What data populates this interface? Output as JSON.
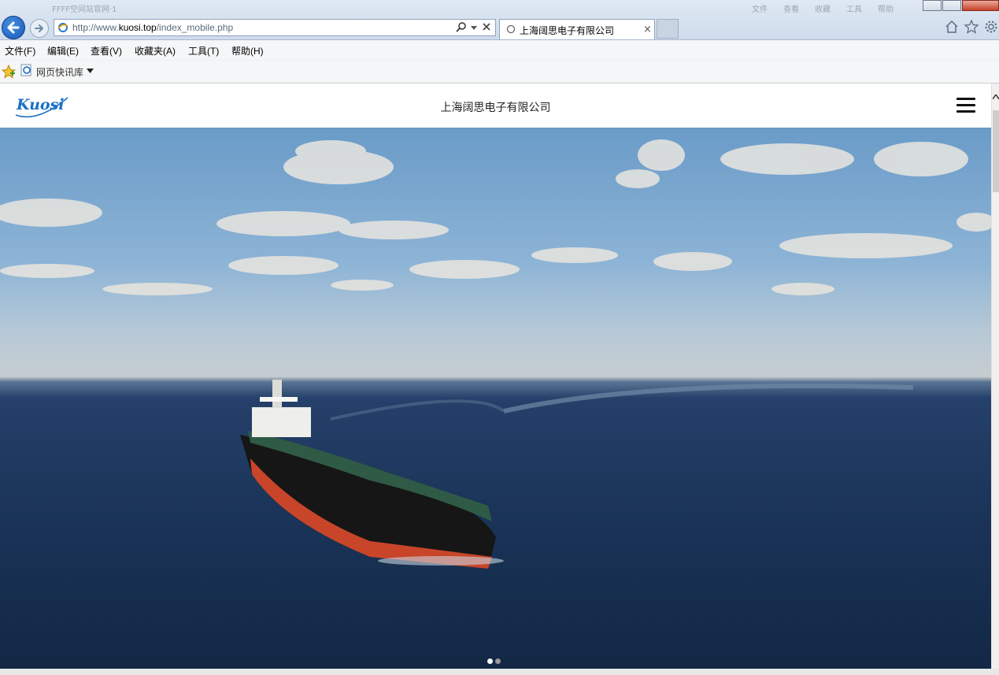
{
  "window": {
    "faint_title": "FFFF空间站官网·1",
    "faint_items": [
      "文件",
      "查看",
      "收藏",
      "工具",
      "帮助"
    ]
  },
  "address_bar": {
    "url_prefix": "http://www.",
    "url_domain": "kuosi.top",
    "url_path": "/index_mobile.php"
  },
  "tab": {
    "title": "上海阔思电子有限公司",
    "close": "×"
  },
  "menu": {
    "items": [
      "文件(F)",
      "编辑(E)",
      "查看(V)",
      "收藏夹(A)",
      "工具(T)",
      "帮助(H)"
    ]
  },
  "favorites": {
    "label": "网页快讯库"
  },
  "site": {
    "logo_text": "Kuosi",
    "title": "上海阔思电子有限公司",
    "slide_count": 2,
    "active_slide": 1
  },
  "colors": {
    "logo_blue": "#1a6fc4",
    "dot_active": "#ffffff",
    "dot_inactive": "#9a9a9a"
  },
  "icons": [
    "back-arrow-icon",
    "forward-arrow-icon",
    "ie-page-icon",
    "search-icon",
    "stop-icon",
    "loading-icon",
    "home-icon",
    "favorites-star-icon",
    "gear-icon",
    "hamburger-menu-icon"
  ]
}
